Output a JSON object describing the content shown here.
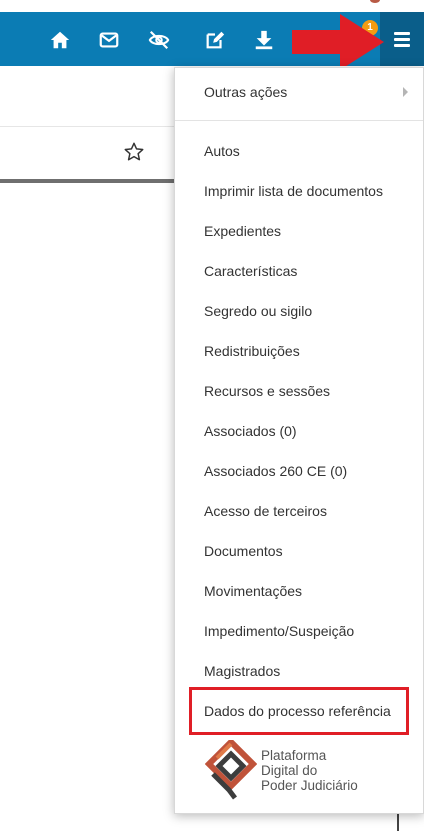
{
  "navbar": {
    "background": "#0b7cb4",
    "icons": [
      "home-icon",
      "envelope-icon",
      "eye-slash-icon",
      "edit-icon",
      "download-icon",
      "menu-icon"
    ],
    "notification_count": "1"
  },
  "menu": {
    "submenu_label": "Outras ações",
    "items": [
      "Autos",
      "Imprimir lista de documentos",
      "Expedientes",
      "Características",
      "Segredo ou sigilo",
      "Redistribuições",
      "Recursos e sessões",
      "Associados (0)",
      "Associados 260 CE (0)",
      "Acesso de terceiros",
      "Documentos",
      "Movimentações",
      "Impedimento/Suspeição",
      "Magistrados",
      "Dados do processo referência"
    ]
  },
  "logo": {
    "line1": "Plataforma",
    "line2": "Digital do",
    "line3": "Poder Judiciário"
  },
  "colors": {
    "accent_red": "#e01e26",
    "menu_toggle_bg": "#0a5e8a",
    "badge": "#f39c12"
  }
}
